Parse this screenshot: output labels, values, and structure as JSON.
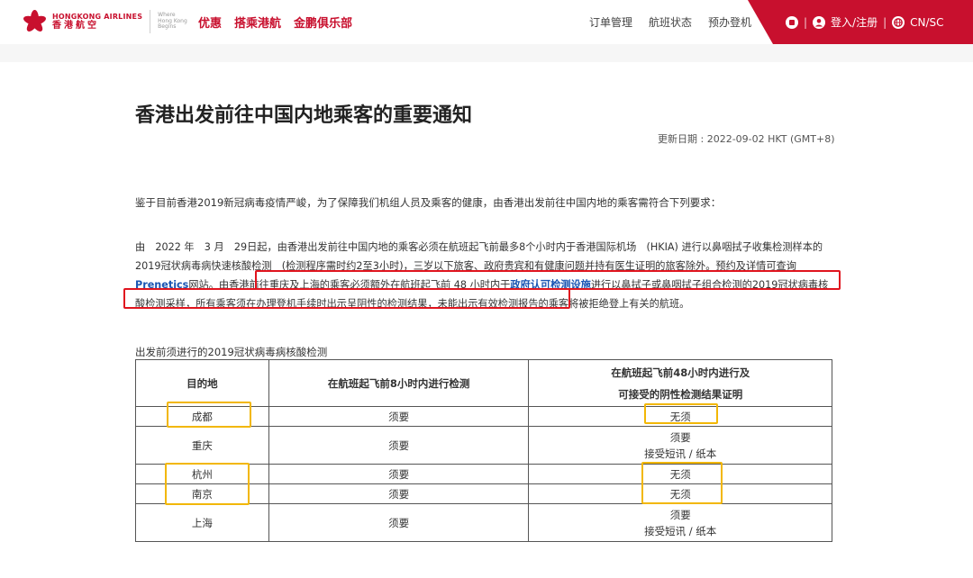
{
  "header": {
    "logo_en": "HONGKONG AIRLINES",
    "logo_zh": "香港航空",
    "slogan": [
      "Where",
      "Hong Kong",
      "Begins"
    ],
    "nav_left": [
      "优惠",
      "搭乘港航",
      "金鹏俱乐部"
    ],
    "nav_right": [
      "订单管理",
      "航班状态",
      "预办登机"
    ],
    "login_label": "登入/注册",
    "language_label": "CN/SC",
    "brand_color": "#c8102e"
  },
  "page": {
    "title": "香港出发前往中国内地乘客的重要通知",
    "update_date": "更新日期 : 2022-09-02 HKT (GMT+8)",
    "intro": "鉴于目前香港2019新冠病毒疫情严峻，为了保障我们机组人员及乘客的健康，由香港出发前往中国内地的乘客需符合下列要求：",
    "para_part1": "由　2022 年　3 月　29日起，由香港出发前往中国内地的乘客必须在航班起飞前最多8个小时内于香港国际机场　(HKIA) 进行以鼻咽拭子收集检测样本的2019冠状病毒病快速核酸检测　(检测程序需时约2至3小时)，三岁以下旅客、政府贵宾和有健康问题并持有医生证明的旅客除外。预约及详情可查询",
    "para_link1": "Prenetics",
    "para_part2": "网站。由香港前往重庆及上海的乘客必须额外在航班起飞前 48 小时内于",
    "para_link2": "政府认可检测设施",
    "para_part3": "进行以鼻拭子或鼻咽拭子组合检测的2019冠状病毒核酸检测采样，所有乘客须在办理登机手续时出示呈阴性的检测结果，未能出示有效检测报告的乘客将被拒绝登上有关的航班。",
    "section_label": "出发前须进行的2019冠状病毒病核酸检测"
  },
  "table": {
    "headers": [
      "目的地",
      "在航班起飞前8小时内进行检测",
      "在航班起飞前48小时内进行及",
      "可接受的阴性检测结果证明"
    ],
    "rows": [
      {
        "city": "成都",
        "test8": "须要",
        "test48": "无须",
        "proof": ""
      },
      {
        "city": "重庆",
        "test8": "须要",
        "test48": "须要",
        "proof": "接受短讯 / 纸本"
      },
      {
        "city": "杭州",
        "test8": "须要",
        "test48": "无须",
        "proof": ""
      },
      {
        "city": "南京",
        "test8": "须要",
        "test48": "无须",
        "proof": ""
      },
      {
        "city": "上海",
        "test8": "须要",
        "test48": "须要",
        "proof": "接受短讯 / 纸本"
      }
    ]
  },
  "colors": {
    "highlight_red": "#e0141e",
    "highlight_yellow": "#f2b705",
    "link_blue": "#1a56b3"
  }
}
